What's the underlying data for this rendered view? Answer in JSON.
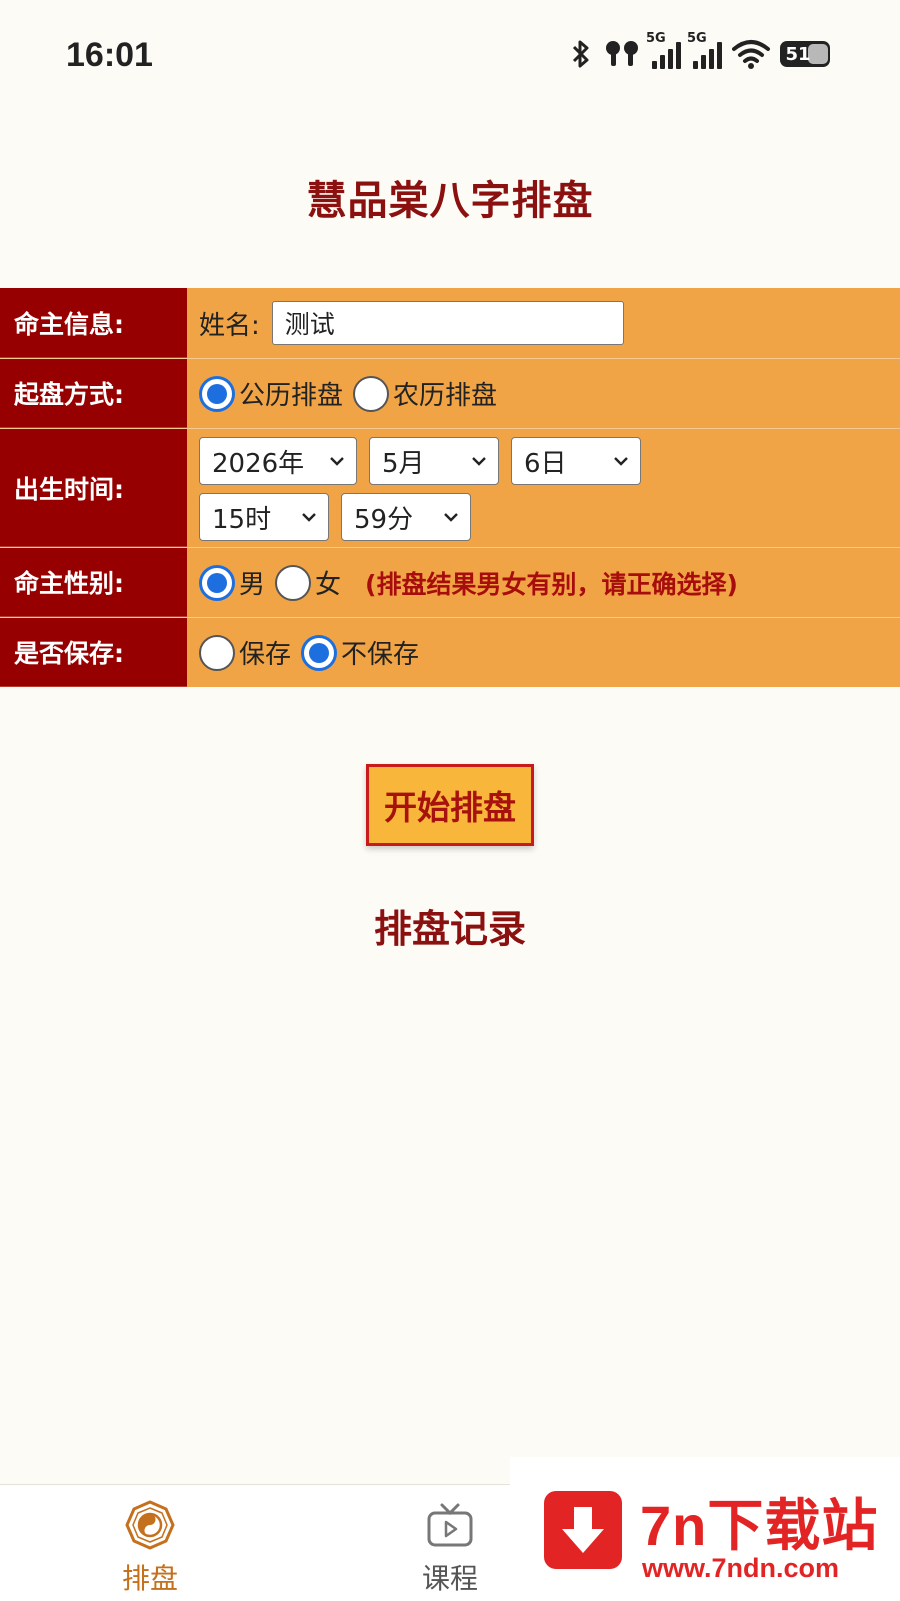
{
  "status_bar": {
    "time": "16:01",
    "signal_label_1": "5G",
    "signal_label_2": "5G",
    "battery": "51",
    "icons": [
      "bluetooth-icon",
      "earbuds-icon",
      "signal-icon",
      "signal-icon",
      "wifi-icon",
      "battery-icon"
    ]
  },
  "page": {
    "title": "慧品棠八字排盘"
  },
  "form": {
    "info": {
      "label": "命主信息:",
      "name_label": "姓名:",
      "name_value": "测试"
    },
    "method": {
      "label": "起盘方式:",
      "options": [
        "公历排盘",
        "农历排盘"
      ],
      "selected": "公历排盘"
    },
    "birth": {
      "label": "出生时间:",
      "year": "2026年",
      "month": "5月",
      "day": "6日",
      "hour": "15时",
      "minute": "59分"
    },
    "gender": {
      "label": "命主性别:",
      "options": [
        "男",
        "女"
      ],
      "selected": "男",
      "hint": "(排盘结果男女有别，请正确选择)"
    },
    "save": {
      "label": "是否保存:",
      "options": [
        "保存",
        "不保存"
      ],
      "selected": "不保存"
    }
  },
  "actions": {
    "start_label": "开始排盘"
  },
  "records": {
    "title": "排盘记录"
  },
  "bottom_nav": {
    "items": [
      {
        "label": "排盘",
        "icon": "bagua-icon",
        "active": true
      },
      {
        "label": "课程",
        "icon": "tv-play-icon",
        "active": false
      }
    ],
    "active_color": "#c4701c"
  },
  "watermark": {
    "name": "7n下载站",
    "url": "www.7ndn.com",
    "icon": "download-arrow-icon"
  },
  "colors": {
    "title": "#8b1010",
    "label_bg": "#970000",
    "content_bg": "#f1a445",
    "button_bg": "#f8b73a",
    "radio": "#1d6fe0"
  }
}
